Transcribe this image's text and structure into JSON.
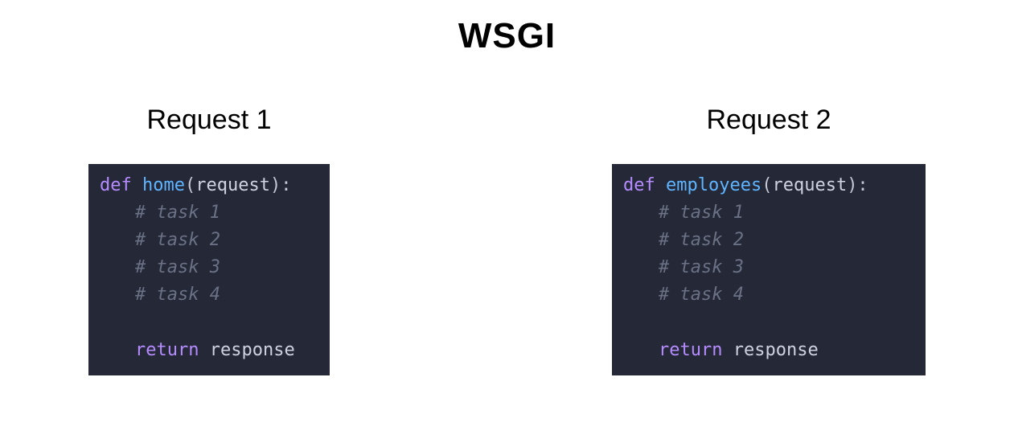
{
  "title": "WSGI",
  "cols": [
    {
      "heading": "Request 1",
      "code": {
        "kw_def": "def",
        "fn": "home",
        "open": "(",
        "param": "request",
        "close": "):",
        "c1": "# task 1",
        "c2": "# task 2",
        "c3": "# task 3",
        "c4": "# task 4",
        "kw_ret": "return",
        "ret_val": " response"
      }
    },
    {
      "heading": "Request 2",
      "code": {
        "kw_def": "def",
        "fn": "employees",
        "open": "(",
        "param": "request",
        "close": "):",
        "c1": "# task 1",
        "c2": "# task 2",
        "c3": "# task 3",
        "c4": "# task 4",
        "kw_ret": "return",
        "ret_val": " response"
      }
    }
  ]
}
